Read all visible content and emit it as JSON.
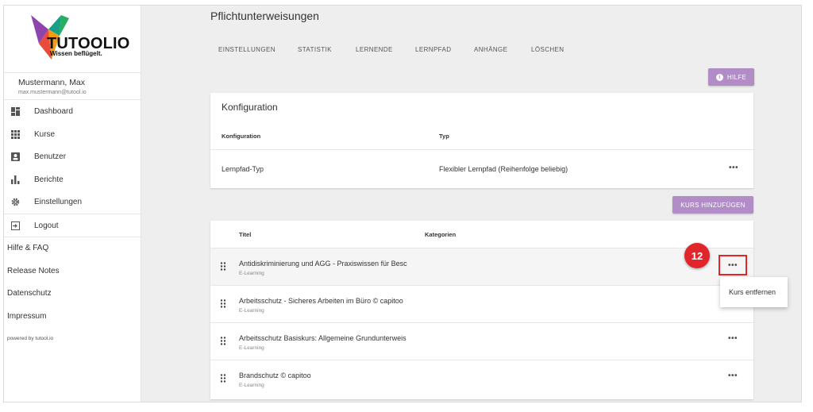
{
  "brand": {
    "name": "TUTOOLIO",
    "slogan": "Wissen beflügelt."
  },
  "user": {
    "name": "Mustermann, Max",
    "email": "max.mustermann@tutool.io"
  },
  "sidebar": {
    "items": [
      {
        "label": "Dashboard",
        "icon": "dashboard-icon"
      },
      {
        "label": "Kurse",
        "icon": "grid-icon"
      },
      {
        "label": "Benutzer",
        "icon": "user-icon"
      },
      {
        "label": "Berichte",
        "icon": "bar-chart-icon"
      },
      {
        "label": "Einstellungen",
        "icon": "gear-icon"
      },
      {
        "label": "Logout",
        "icon": "logout-icon"
      }
    ],
    "links": [
      "Hilfe & FAQ",
      "Release Notes",
      "Datenschutz",
      "Impressum"
    ],
    "powered": "powered by tutool.io"
  },
  "page": {
    "title": "Pflichtunterweisungen"
  },
  "tabs": [
    "EINSTELLUNGEN",
    "STATISTIK",
    "LERNENDE",
    "LERNPFAD",
    "ANHÄNGE",
    "LÖSCHEN"
  ],
  "help_button": "HILFE",
  "config": {
    "title": "Konfiguration",
    "columns": [
      "Konfiguration",
      "Typ"
    ],
    "row": {
      "name": "Lernpfad-Typ",
      "type": "Flexibler Lernpfad (Reihenfolge beliebig)"
    },
    "actions": "•••"
  },
  "add_course_button": "KURS HINZUFÜGEN",
  "courses": {
    "columns": [
      "Titel",
      "Kategorien"
    ],
    "rows": [
      {
        "title": "Antidiskriminierung und AGG - Praxiswissen für Besc",
        "category": "E-Learning"
      },
      {
        "title": "Arbeitsschutz - Sicheres Arbeiten im Büro © capitoo",
        "category": "E-Learning"
      },
      {
        "title": "Arbeitsschutz Basiskurs: Allgemeine Grundunterweis",
        "category": "E-Learning"
      },
      {
        "title": "Brandschutz © capitoo",
        "category": "E-Learning"
      }
    ],
    "actions": "•••"
  },
  "context_menu": {
    "item": "Kurs entfernen"
  },
  "step_marker": "12",
  "colors": {
    "accent": "#b18cc6",
    "marker": "#e0262a"
  }
}
